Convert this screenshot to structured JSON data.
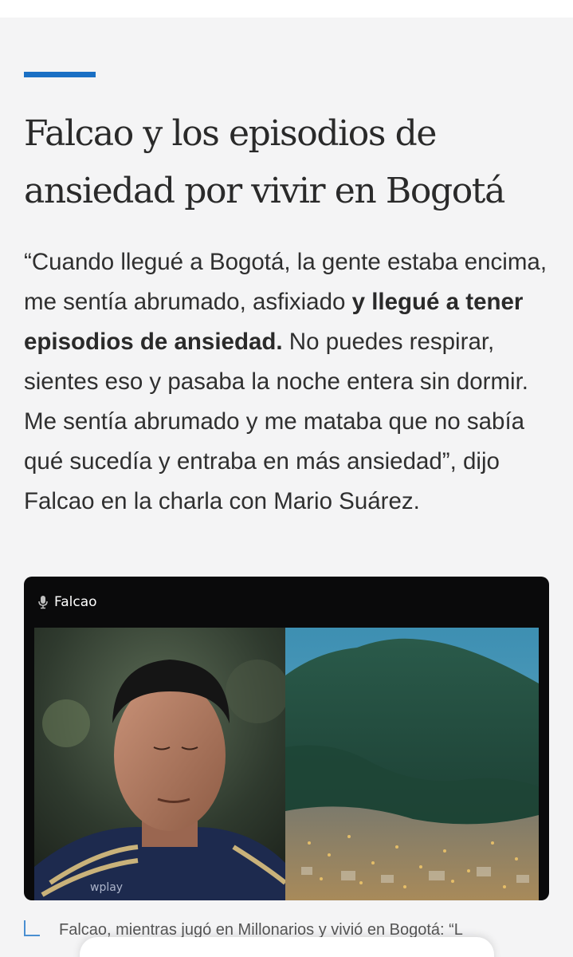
{
  "article": {
    "headline": "Falcao y los episodios de ansiedad por vivir en Bogotá",
    "paragraph": {
      "part1": "“Cuando llegué a Bogotá, la gente estaba encima, me sentía abrumado, asfixiado ",
      "bold": "y llegué a tener episodios de ansiedad.",
      "part2": " No puedes respirar, sientes eso y pasaba la noche entera sin dormir. Me sentía abrumado y me mataba que no sabía qué sucedía y entraba en más ansiedad”, dijo Falcao en la charla con Mario Suárez."
    },
    "media": {
      "label": "Falcao",
      "label_icon": "microphone-icon"
    },
    "caption": "Falcao, mientras jugó en Millonarios y vivió en Bogotá: “L"
  },
  "colors": {
    "accent": "#1a6fc4",
    "background": "#f4f4f5",
    "text": "#2f2f2f"
  }
}
